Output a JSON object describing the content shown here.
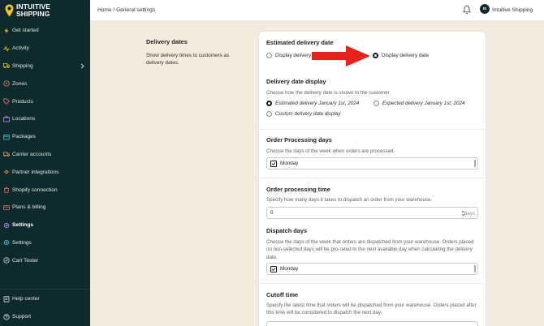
{
  "brand": {
    "line1": "INTUITIVE",
    "line2": "SHIPPING"
  },
  "sidebar": {
    "items": [
      {
        "label": "Get started",
        "icon": "bolt-icon"
      },
      {
        "label": "Activity",
        "icon": "activity-icon"
      },
      {
        "label": "Shipping",
        "icon": "shipping-icon",
        "has_chevron": true
      },
      {
        "label": "Zones",
        "icon": "zones-icon"
      },
      {
        "label": "Products",
        "icon": "tag-icon"
      },
      {
        "label": "Locations",
        "icon": "location-icon"
      },
      {
        "label": "Packages",
        "icon": "package-icon"
      },
      {
        "label": "Carrier accounts",
        "icon": "carrier-icon"
      },
      {
        "label": "Partner integrations",
        "icon": "integrations-icon"
      },
      {
        "label": "Shopify connection",
        "icon": "shopify-icon"
      },
      {
        "label": "Plans & billing",
        "icon": "billing-icon"
      },
      {
        "label": "Settings",
        "icon": "gear-icon",
        "active": true
      },
      {
        "label": "Settings",
        "icon": "gear-icon"
      },
      {
        "label": "Cart Tester",
        "icon": "cart-icon"
      }
    ],
    "bottom": [
      {
        "label": "Help center",
        "icon": "help-icon"
      },
      {
        "label": "Support",
        "icon": "support-icon"
      }
    ]
  },
  "header": {
    "breadcrumb": "Home / General settings",
    "avatar_initials": "IS",
    "store_name": "Intuitive Shipping"
  },
  "section": {
    "title": "Delivery dates",
    "description": "Show delivery times to customers as delivery dates."
  },
  "card": {
    "estimated": {
      "title": "Estimated delivery date",
      "option_a": "Display delivery d",
      "option_b": "Display delivery date"
    },
    "display": {
      "title": "Delivery date display",
      "subtitle": "Choose how the delivery date is shown to the customer.",
      "option_estimated": "Estimated delivery January 1st, 2024",
      "option_expected": "Expected delivery January 1st, 2024",
      "option_custom": "Custom delivery date display"
    },
    "processing_days": {
      "title": "Order Processing days",
      "subtitle": "Choose the days of the week when orders are processed.",
      "first_option": "Monday"
    },
    "processing_time": {
      "title": "Order processing time",
      "subtitle": "Specify how many days it takes to dispatch an order from your warehouse.",
      "value": "0",
      "suffix": "days"
    },
    "dispatch_days": {
      "title": "Dispatch days",
      "subtitle": "Choose the days of the week that orders are dispatched from your warehouse. Orders placed on non-selected days will be pro-rated to the next available day when calculating the delivery date.",
      "first_option": "Monday"
    },
    "cutoff": {
      "title": "Cutoff time",
      "subtitle": "Specify the latest time that orders will be dispatched from your warehouse. Orders placed after this time will be considered to dispatch the next day."
    }
  },
  "colors": {
    "sidebar_bg": "#0f2a2d",
    "page_bg": "#f3ecdd",
    "annotation_arrow": "#e8231c",
    "brand_yellow": "#f5c518"
  }
}
